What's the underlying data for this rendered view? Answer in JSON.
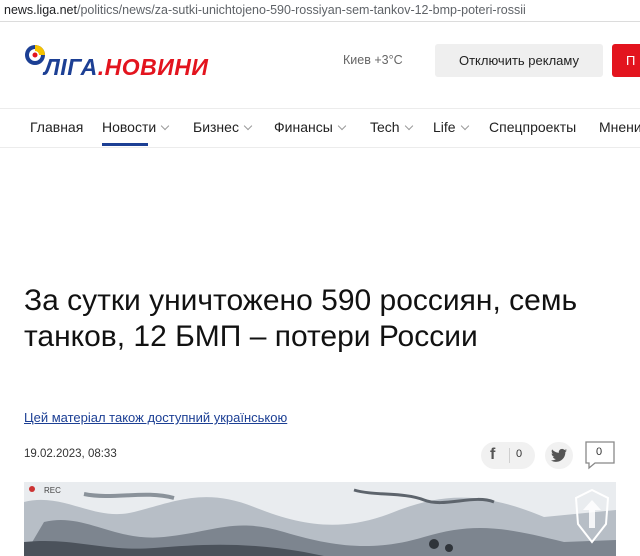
{
  "browser": {
    "url_host": "news.liga.net",
    "url_path": "/politics/news/za-sutki-unichtojeno-590-rossiyan-sem-tankov-12-bmp-poteri-rossii"
  },
  "header": {
    "logo_brand": "ЛIГА",
    "logo_dot": ".",
    "logo_section": "НОВИНИ",
    "weather": "Киев +3°C",
    "ad_button": "Отключить рекламу",
    "red_button": "П"
  },
  "nav": {
    "items": [
      {
        "label": "Главная"
      },
      {
        "label": "Новости"
      },
      {
        "label": "Бизнес"
      },
      {
        "label": "Финансы"
      },
      {
        "label": "Tech"
      },
      {
        "label": "Life"
      },
      {
        "label": "Спецпроекты"
      },
      {
        "label": "Мнени"
      }
    ]
  },
  "article": {
    "headline": "За сутки уничтожено 590 россиян, семь танков, 12 БМП – потери России",
    "language_link": "Цей матеріал також доступний українською",
    "date": "19.02.2023, 08:33",
    "facebook_count": "0",
    "comments_count": "0",
    "image_rec_label": "REC"
  },
  "colors": {
    "brand_blue": "#1c3f94",
    "brand_red": "#e3141e"
  },
  "icons": {
    "logo_mark": "liga-logo-icon",
    "facebook": "facebook-icon",
    "twitter": "twitter-icon",
    "comment": "comment-bubble-icon"
  }
}
